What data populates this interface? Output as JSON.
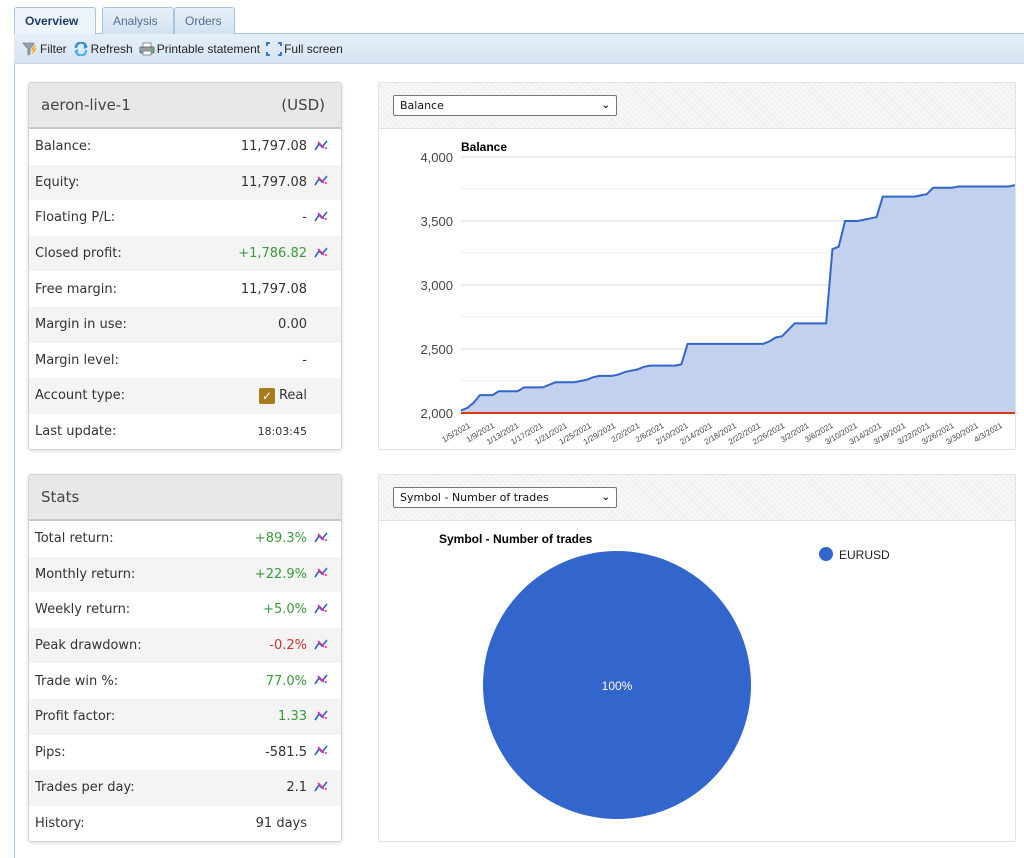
{
  "tabs": [
    {
      "label": "Overview",
      "active": true
    },
    {
      "label": "Analysis",
      "active": false
    },
    {
      "label": "Orders",
      "active": false
    }
  ],
  "toolbar": {
    "filter": {
      "label": "Filter",
      "icon": "filter-icon"
    },
    "refresh": {
      "label": "Refresh",
      "icon": "refresh-icon"
    },
    "print": {
      "label": "Printable statement",
      "icon": "printer-icon"
    },
    "fullscreen": {
      "label": "Full screen",
      "icon": "fullscreen-icon"
    }
  },
  "account": {
    "name": "aeron-live-1",
    "currency": "(USD)",
    "rows": [
      {
        "label": "Balance:",
        "value": "11,797.08",
        "color": "",
        "chart_icon": true
      },
      {
        "label": "Equity:",
        "value": "11,797.08",
        "color": "",
        "chart_icon": true
      },
      {
        "label": "Floating P/L:",
        "value": "-",
        "color": "",
        "chart_icon": true
      },
      {
        "label": "Closed profit:",
        "value": "+1,786.82",
        "color": "green",
        "chart_icon": true
      },
      {
        "label": "Free margin:",
        "value": "11,797.08",
        "color": "",
        "chart_icon": false
      },
      {
        "label": "Margin in use:",
        "value": "0.00",
        "color": "",
        "chart_icon": false
      },
      {
        "label": "Margin level:",
        "value": "-",
        "color": "",
        "chart_icon": false
      },
      {
        "label": "Account type:",
        "value": "Real",
        "color": "",
        "chart_icon": false,
        "checkbox": true
      },
      {
        "label": "Last update:",
        "value": "18:03:45",
        "color": "",
        "chart_icon": false,
        "small": true
      }
    ]
  },
  "stats": {
    "title": "Stats",
    "rows": [
      {
        "label": "Total return:",
        "value": "+89.3%",
        "color": "green",
        "chart_icon": true
      },
      {
        "label": "Monthly return:",
        "value": "+22.9%",
        "color": "green",
        "chart_icon": true
      },
      {
        "label": "Weekly return:",
        "value": "+5.0%",
        "color": "green",
        "chart_icon": true
      },
      {
        "label": "Peak drawdown:",
        "value": "-0.2%",
        "color": "red",
        "chart_icon": true
      },
      {
        "label": "Trade win %:",
        "value": "77.0%",
        "color": "green",
        "chart_icon": true
      },
      {
        "label": "Profit factor:",
        "value": "1.33",
        "color": "green",
        "chart_icon": true
      },
      {
        "label": "Pips:",
        "value": "-581.5",
        "color": "",
        "chart_icon": true
      },
      {
        "label": "Trades per day:",
        "value": "2.1",
        "color": "",
        "chart_icon": true
      },
      {
        "label": "History:",
        "value": "91 days",
        "color": "",
        "chart_icon": false
      }
    ]
  },
  "balance_select": {
    "value": "Balance"
  },
  "pie_select": {
    "value": "Symbol - Number of trades"
  },
  "chart_data": [
    {
      "type": "area",
      "title": "Balance",
      "xlabel": "",
      "ylabel": "",
      "ylim": [
        2000,
        3800
      ],
      "yticks": [
        2000,
        2500,
        3000,
        3500,
        4000
      ],
      "ytick_labels": [
        "2,000",
        "2,500",
        "3,000",
        "3,500",
        "4,000"
      ],
      "grid": true,
      "xtick_labels": [
        "1/5/2021",
        "1/9/2021",
        "1/13/2021",
        "1/17/2021",
        "1/21/2021",
        "1/25/2021",
        "1/29/2021",
        "2/2/2021",
        "2/6/2021",
        "2/10/2021",
        "2/14/2021",
        "2/18/2021",
        "2/22/2021",
        "2/26/2021",
        "3/2/2021",
        "3/6/2021",
        "3/10/2021",
        "3/14/2021",
        "3/18/2021",
        "3/22/2021",
        "3/26/2021",
        "3/30/2021",
        "4/3/2021"
      ],
      "colors": {
        "line": "#3366cc",
        "fill": "#c2d1ee",
        "baseline": "#dc3912"
      },
      "series": [
        {
          "name": "Balance",
          "x": [
            0,
            1,
            2,
            3,
            4,
            5,
            6,
            7,
            8,
            9,
            10,
            11,
            12,
            13,
            14,
            15,
            16,
            17,
            18,
            19,
            20,
            21,
            22,
            23,
            24,
            25,
            26,
            27,
            28,
            29,
            30,
            31,
            32,
            33,
            34,
            35,
            36,
            37,
            38,
            39,
            40,
            41,
            42,
            43,
            44,
            45,
            46,
            47,
            48,
            49,
            50,
            51,
            52,
            53,
            54,
            55,
            56,
            57,
            58,
            59,
            60,
            61,
            62,
            63,
            64,
            65,
            66,
            67,
            68,
            69,
            70,
            71,
            72,
            73,
            74,
            75,
            76,
            77,
            78,
            79,
            80,
            81,
            82,
            83,
            84,
            85,
            86,
            87,
            88
          ],
          "values": [
            2020,
            2040,
            2080,
            2140,
            2140,
            2140,
            2170,
            2170,
            2170,
            2170,
            2200,
            2200,
            2200,
            2200,
            2220,
            2240,
            2240,
            2240,
            2240,
            2250,
            2260,
            2280,
            2290,
            2290,
            2290,
            2300,
            2320,
            2330,
            2340,
            2360,
            2370,
            2370,
            2370,
            2370,
            2370,
            2380,
            2540,
            2540,
            2540,
            2540,
            2540,
            2540,
            2540,
            2540,
            2540,
            2540,
            2540,
            2540,
            2540,
            2560,
            2590,
            2600,
            2650,
            2700,
            2700,
            2700,
            2700,
            2700,
            2700,
            3280,
            3300,
            3500,
            3500,
            3500,
            3510,
            3520,
            3530,
            3690,
            3690,
            3690,
            3690,
            3690,
            3690,
            3700,
            3710,
            3760,
            3760,
            3760,
            3760,
            3770,
            3770,
            3770,
            3770,
            3770,
            3770,
            3770,
            3770,
            3770,
            3780
          ]
        },
        {
          "name": "Baseline",
          "values_constant": 2000
        }
      ]
    },
    {
      "type": "pie",
      "title": "Symbol - Number of trades",
      "categories": [
        "EURUSD"
      ],
      "values": [
        100
      ],
      "labels": [
        "100%"
      ],
      "colors": [
        "#3366cc"
      ],
      "legend": "right"
    }
  ]
}
